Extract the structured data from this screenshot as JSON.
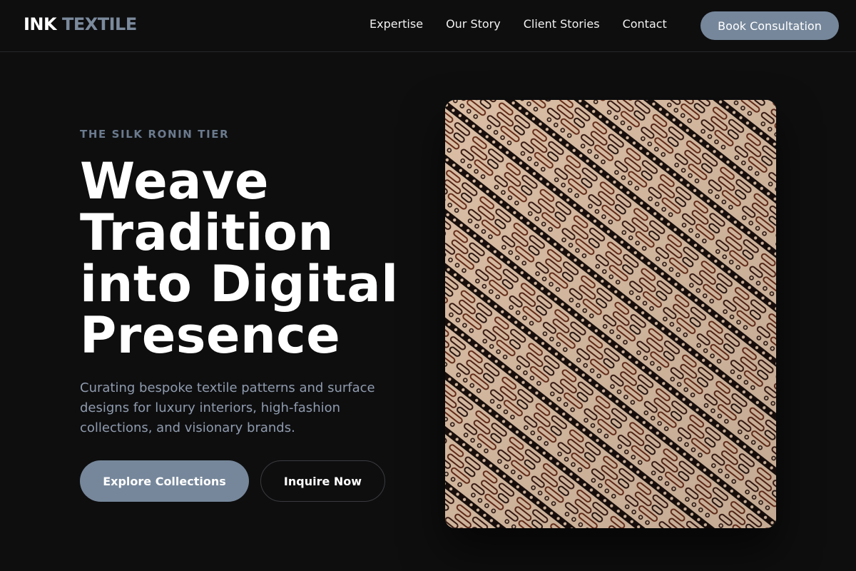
{
  "brand": {
    "part1": "INK",
    "part2": "TEXTILE"
  },
  "nav": {
    "links": [
      "Expertise",
      "Our Story",
      "Client Stories",
      "Contact"
    ],
    "cta": "Book Consultation"
  },
  "hero": {
    "eyebrow": "THE SILK RONIN TIER",
    "title_lines": [
      "Weave",
      "Tradition",
      "into Digital",
      "Presence"
    ],
    "description": "Curating bespoke textile patterns and surface designs for luxury interiors, high-fashion collections, and visionary brands.",
    "primary_button": "Explore Collections",
    "secondary_button": "Inquire Now"
  },
  "image": {
    "alt": "batik textile pattern",
    "colors": {
      "base": "#e6c8ad",
      "ink": "#1a0f0c",
      "rust": "#6b2e1a"
    }
  }
}
